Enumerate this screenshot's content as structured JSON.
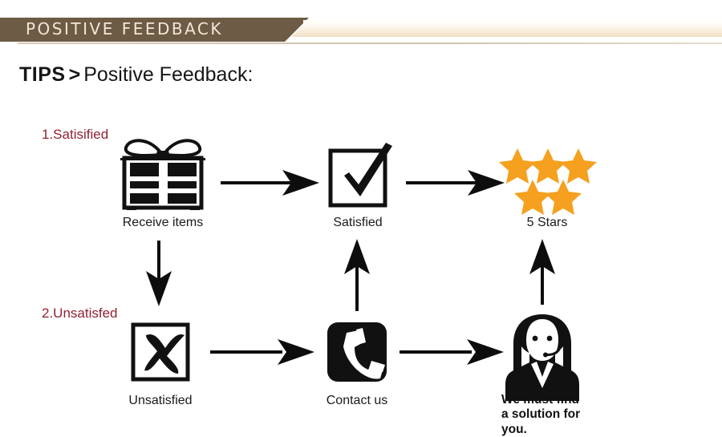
{
  "banner": {
    "title": "POSITIVE  FEEDBACK",
    "brown_hex": "#6d5b46",
    "text_hex": "#f3e6d6"
  },
  "heading": {
    "strong": "TIPS",
    "chevron": ">",
    "light": "Positive Feedback:"
  },
  "flow": {
    "rows": [
      {
        "tag": "1.Satisified",
        "tag_hex": "#8f2232",
        "nodes": [
          {
            "icon": "gift-box-icon",
            "label": "Receive items"
          },
          {
            "icon": "checkmark-box-icon",
            "label": "Satisfied"
          },
          {
            "icon": "five-stars-icon",
            "label": "5 Stars"
          }
        ]
      },
      {
        "tag": "2.Unsatisfed",
        "tag_hex": "#8f2232",
        "nodes": [
          {
            "icon": "cross-box-icon",
            "label": "Unsatisfied"
          },
          {
            "icon": "telephone-icon",
            "label": "Contact us"
          },
          {
            "icon": "support-agent-icon",
            "label": "We must find\na solution for\nyou."
          }
        ]
      }
    ],
    "stars": {
      "count": 5,
      "color_hex": "#f5a01e"
    },
    "arrow_color_hex": "#0d0d0d",
    "icon_color_hex": "#111111"
  }
}
